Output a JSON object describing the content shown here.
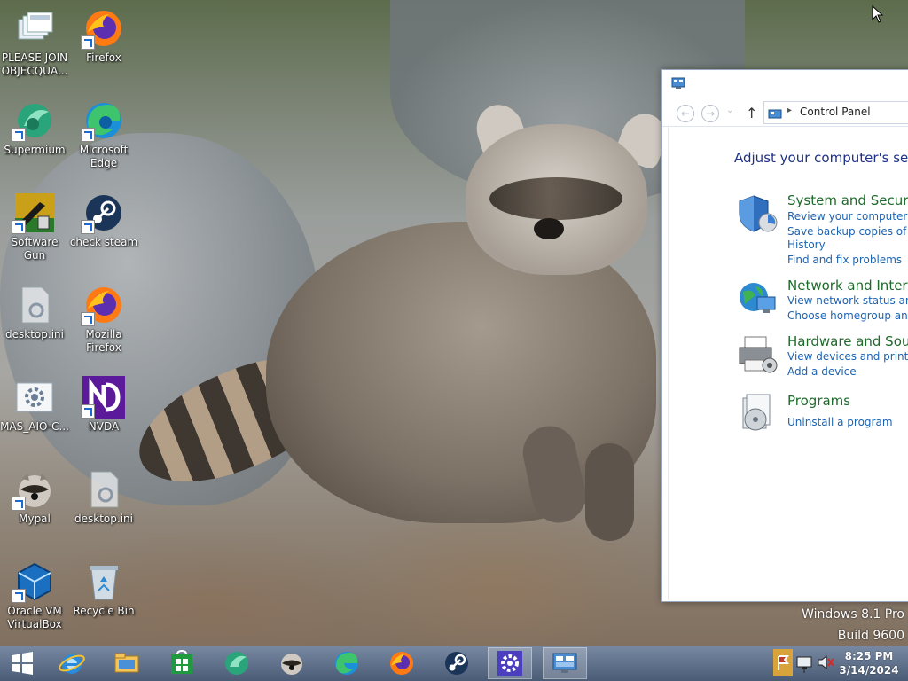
{
  "desktop": {
    "icons": [
      {
        "label": "PLEASE JOIN OBJECQUA...",
        "icon": "file-stack-icon"
      },
      {
        "label": "Firefox",
        "icon": "firefox-icon"
      },
      {
        "label": "Supermium",
        "icon": "supermium-icon"
      },
      {
        "label": "Microsoft Edge",
        "icon": "edge-icon"
      },
      {
        "label": "Software Gun",
        "icon": "software-gun-icon"
      },
      {
        "label": "check steam",
        "icon": "steam-icon"
      },
      {
        "label": "desktop.ini",
        "icon": "ini-file-icon"
      },
      {
        "label": "Mozilla Firefox",
        "icon": "firefox-icon"
      },
      {
        "label": "MAS_AIO-C...",
        "icon": "gear-file-icon"
      },
      {
        "label": "NVDA",
        "icon": "nvda-icon"
      },
      {
        "label": "Mypal",
        "icon": "mypal-raccoon-icon"
      },
      {
        "label": "desktop.ini",
        "icon": "ini-file-icon"
      },
      {
        "label": "Oracle VM VirtualBox",
        "icon": "virtualbox-icon"
      },
      {
        "label": "Recycle Bin",
        "icon": "recycle-bin-icon"
      }
    ]
  },
  "control_panel": {
    "address": "Control Panel",
    "heading": "Adjust your computer's settin",
    "categories": [
      {
        "title": "System and Security",
        "links": [
          "Review your computer's st",
          "Save backup copies of you",
          "History",
          "Find and fix problems"
        ]
      },
      {
        "title": "Network and Interne",
        "links": [
          "View network status and ta",
          "Choose homegroup and s"
        ]
      },
      {
        "title": "Hardware and Sound",
        "links": [
          "View devices and printers",
          "Add a device"
        ]
      },
      {
        "title": "Programs",
        "links": [
          "Uninstall a program"
        ]
      }
    ]
  },
  "watermark": {
    "line1": "Windows 8.1 Pro",
    "line2": "Build 9600"
  },
  "taskbar": {
    "items": [
      "start-icon",
      "internet-explorer-icon",
      "file-explorer-icon",
      "store-icon",
      "supermium-icon",
      "mypal-raccoon-icon",
      "edge-icon",
      "firefox-icon",
      "steam-icon",
      "settings-icon",
      "control-panel-icon"
    ]
  },
  "clock": {
    "time": "8:25 PM",
    "date": "3/14/2024"
  },
  "colors": {
    "link": "#1c64b3",
    "category": "#1e6a2a",
    "heading": "#1e3287",
    "taskbar": "#5c7496"
  }
}
